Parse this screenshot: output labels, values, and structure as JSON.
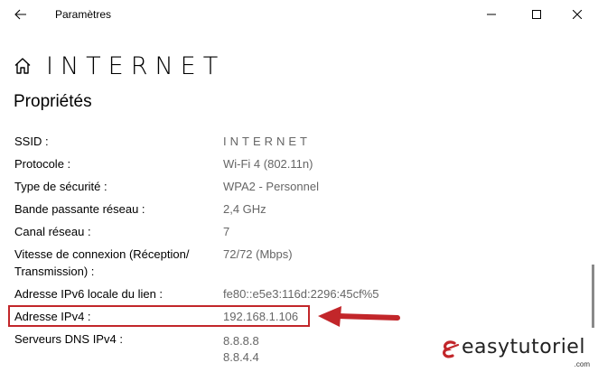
{
  "window": {
    "title": "Paramètres",
    "back_icon": "back-arrow-icon",
    "minimize_icon": "minimize-icon",
    "maximize_icon": "maximize-icon",
    "close_icon": "close-icon"
  },
  "header": {
    "icon": "home-icon",
    "network_name": "INTERNET"
  },
  "section": {
    "title": "Propriétés"
  },
  "properties": [
    {
      "label": "SSID :",
      "value": "INTERNET"
    },
    {
      "label": "Protocole :",
      "value": "Wi-Fi 4 (802.11n)"
    },
    {
      "label": "Type de sécurité :",
      "value": "WPA2 - Personnel"
    },
    {
      "label": "Bande passante réseau :",
      "value": "2,4 GHz"
    },
    {
      "label": "Canal réseau :",
      "value": "7"
    },
    {
      "label": "Vitesse de connexion (Réception/ Transmission) :",
      "value": "72/72 (Mbps)"
    },
    {
      "label": "Adresse IPv6 locale du lien :",
      "value": "fe80::e5e3:116d:2296:45cf%5"
    },
    {
      "label": "Adresse IPv4 :",
      "value": "192.168.1.106"
    },
    {
      "label": "Serveurs DNS IPv4 :",
      "value": "8.8.8.8",
      "value2": "8.8.4.4"
    }
  ],
  "annotation": {
    "color": "#c2262a",
    "arrow_icon": "red-arrow-icon"
  },
  "watermark": {
    "name": "easytutoriel",
    "domain": ".com",
    "accent": "#c2262a"
  }
}
